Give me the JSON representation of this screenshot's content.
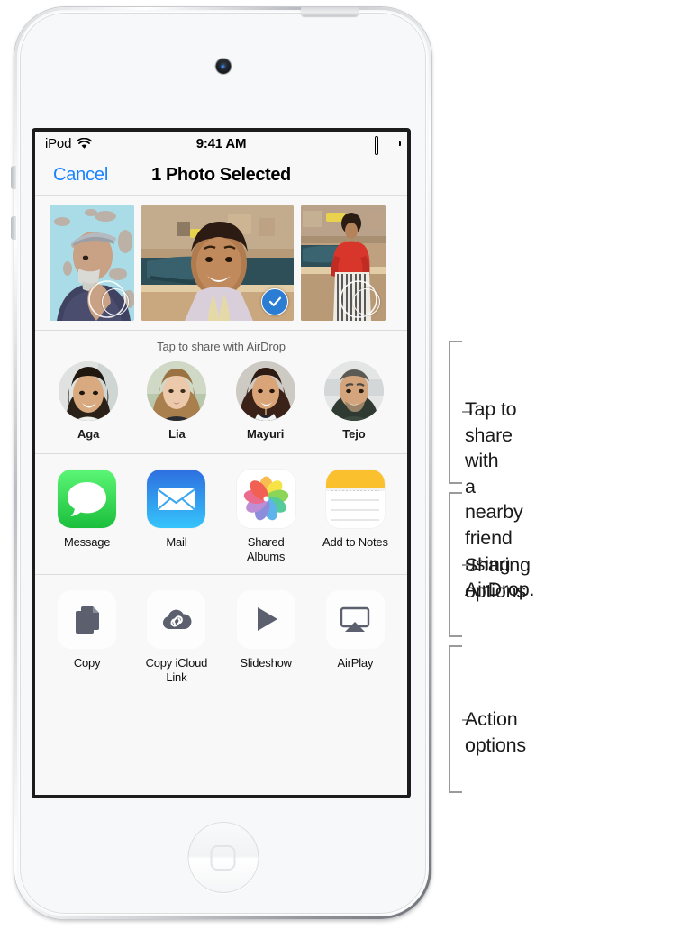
{
  "device": {
    "name": "ipod-touch",
    "color": "#f3f4f6"
  },
  "screen": {
    "status_bar": {
      "carrier": "iPod",
      "wifi_icon": "wifi-icon",
      "time": "9:41 AM",
      "battery_icon": "battery-full-icon"
    },
    "nav_bar": {
      "cancel_label": "Cancel",
      "title": "1 Photo Selected",
      "cancel_color": "#1a84ff"
    },
    "photo_strip": {
      "photos": [
        {
          "alt": "older-man-blue-wall",
          "selected": false,
          "width": "narrow"
        },
        {
          "alt": "smiling-girl-by-car",
          "selected": true,
          "width": "wide"
        },
        {
          "alt": "woman-in-red-top",
          "selected": false,
          "width": "narrow"
        }
      ],
      "selected_color": "#2b7cd3"
    },
    "airdrop": {
      "hint": "Tap to share with AirDrop",
      "people": [
        {
          "name": "Aga",
          "avatar": "avatar-aga"
        },
        {
          "name": "Lia",
          "avatar": "avatar-lia"
        },
        {
          "name": "Mayuri",
          "avatar": "avatar-mayuri"
        },
        {
          "name": "Tejo",
          "avatar": "avatar-tejo"
        }
      ]
    },
    "sharing_options": [
      {
        "label": "Message",
        "icon": "messages-icon"
      },
      {
        "label": "Mail",
        "icon": "mail-icon"
      },
      {
        "label": "Shared\nAlbums",
        "icon": "photos-icon"
      },
      {
        "label": "Add to Notes",
        "icon": "notes-icon"
      }
    ],
    "action_options": [
      {
        "label": "Copy",
        "icon": "copy-icon"
      },
      {
        "label": "Copy iCloud\nLink",
        "icon": "icloud-link-icon"
      },
      {
        "label": "Slideshow",
        "icon": "play-icon"
      },
      {
        "label": "AirPlay",
        "icon": "airplay-icon"
      }
    ]
  },
  "callouts": [
    {
      "text": "Tap to share with\na nearby friend\nusing AirDrop."
    },
    {
      "text": "Sharing options"
    },
    {
      "text": "Action options"
    }
  ]
}
